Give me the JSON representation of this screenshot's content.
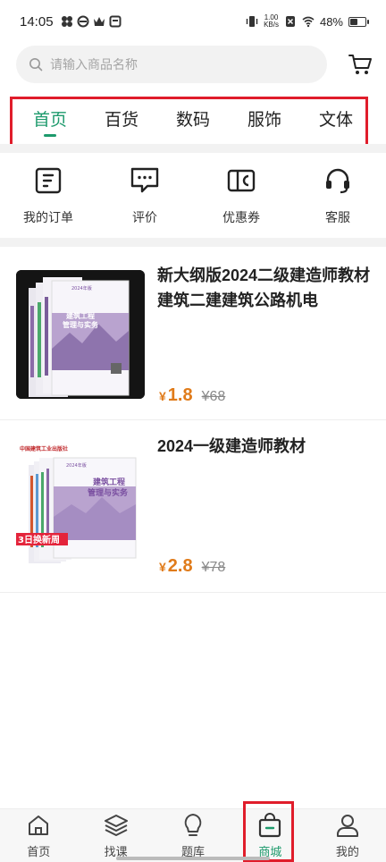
{
  "status": {
    "time": "14:05",
    "net_speed_value": "1.00",
    "net_speed_unit": "KB/s",
    "battery": "48%",
    "battery_level": 0.48
  },
  "search": {
    "placeholder": "请输入商品名称"
  },
  "tabs": [
    {
      "label": "首页",
      "active": true
    },
    {
      "label": "百货"
    },
    {
      "label": "数码"
    },
    {
      "label": "服饰"
    },
    {
      "label": "文体"
    }
  ],
  "quick_actions": [
    {
      "label": "我的订单",
      "icon": "order-icon"
    },
    {
      "label": "评价",
      "icon": "comment-icon"
    },
    {
      "label": "优惠券",
      "icon": "coupon-icon"
    },
    {
      "label": "客服",
      "icon": "headset-icon"
    }
  ],
  "products": [
    {
      "title": "新大纲版2024二级建造师教材建筑二建建筑公路机电",
      "currency": "¥",
      "price": "1.8",
      "old_price": "¥68",
      "image": {
        "badge": "2024年版",
        "book_title_1": "建筑工程",
        "book_title_2": "管理与实务"
      }
    },
    {
      "title": "2024一级建造师教材",
      "currency": "¥",
      "price": "2.8",
      "old_price": "¥78",
      "image": {
        "publisher": "中国建筑工业出版社",
        "badge": "2024年版",
        "book_title_1": "建筑工程",
        "book_title_2": "管理与实务",
        "promo": "3日换新周"
      }
    }
  ],
  "bottom_nav": [
    {
      "label": "首页",
      "icon": "home-icon"
    },
    {
      "label": "找课",
      "icon": "layers-icon"
    },
    {
      "label": "题库",
      "icon": "bulb-icon"
    },
    {
      "label": "商城",
      "icon": "shopping-bag-icon",
      "active": true
    },
    {
      "label": "我的",
      "icon": "person-icon"
    }
  ],
  "colors": {
    "accent": "#1d9a6c",
    "price": "#e07b1a",
    "highlight_box": "#e01d2b"
  }
}
